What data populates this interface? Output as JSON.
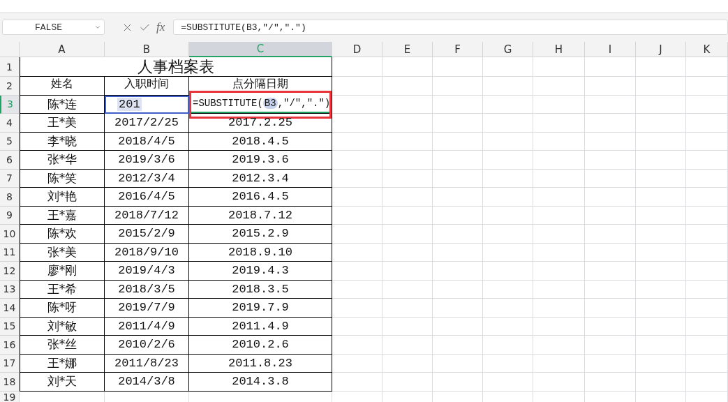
{
  "name_box": "FALSE",
  "formula_bar": {
    "function_label": "fx",
    "text": "=SUBSTITUTE(B3,″/″,″.″)"
  },
  "columns": [
    {
      "label": "A",
      "selected": false
    },
    {
      "label": "B",
      "selected": false
    },
    {
      "label": "C",
      "selected": true
    },
    {
      "label": "D",
      "selected": false
    },
    {
      "label": "E",
      "selected": false
    },
    {
      "label": "F",
      "selected": false
    },
    {
      "label": "G",
      "selected": false
    },
    {
      "label": "H",
      "selected": false
    },
    {
      "label": "I",
      "selected": false
    },
    {
      "label": "J",
      "selected": false
    },
    {
      "label": "K",
      "selected": false
    }
  ],
  "title": "人事档案表",
  "headers": [
    "姓名",
    "入职时间",
    "点分隔日期"
  ],
  "records": [
    {
      "row": "3",
      "selected": true,
      "name": "陈*连",
      "hired": "201",
      "editing": {
        "before": "=SUBSTITUTE(",
        "ref": "B3",
        "after": ",″/″,″.″)"
      }
    },
    {
      "row": "4",
      "selected": false,
      "name": "王*美",
      "hired": "2017/2/25",
      "dotted": "2017.2.25"
    },
    {
      "row": "5",
      "selected": false,
      "name": "李*晓",
      "hired": "2018/4/5",
      "dotted": "2018.4.5"
    },
    {
      "row": "6",
      "selected": false,
      "name": "张*华",
      "hired": "2019/3/6",
      "dotted": "2019.3.6"
    },
    {
      "row": "7",
      "selected": false,
      "name": "陈*笑",
      "hired": "2012/3/4",
      "dotted": "2012.3.4"
    },
    {
      "row": "8",
      "selected": false,
      "name": "刘*艳",
      "hired": "2016/4/5",
      "dotted": "2016.4.5"
    },
    {
      "row": "9",
      "selected": false,
      "name": "王*嘉",
      "hired": "2018/7/12",
      "dotted": "2018.7.12"
    },
    {
      "row": "10",
      "selected": false,
      "name": "陈*欢",
      "hired": "2015/2/9",
      "dotted": "2015.2.9"
    },
    {
      "row": "11",
      "selected": false,
      "name": "张*美",
      "hired": "2018/9/10",
      "dotted": "2018.9.10"
    },
    {
      "row": "12",
      "selected": false,
      "name": "廖*刚",
      "hired": "2019/4/3",
      "dotted": "2019.4.3"
    },
    {
      "row": "13",
      "selected": false,
      "name": "王*希",
      "hired": "2018/3/5",
      "dotted": "2018.3.5"
    },
    {
      "row": "14",
      "selected": false,
      "name": "陈*呀",
      "hired": "2019/7/9",
      "dotted": "2019.7.9"
    },
    {
      "row": "15",
      "selected": false,
      "name": "刘*敏",
      "hired": "2011/4/9",
      "dotted": "2011.4.9"
    },
    {
      "row": "16",
      "selected": false,
      "name": "张*丝",
      "hired": "2010/2/6",
      "dotted": "2010.2.6"
    },
    {
      "row": "17",
      "selected": false,
      "name": "王*娜",
      "hired": "2011/8/23",
      "dotted": "2011.8.23"
    },
    {
      "row": "18",
      "selected": false,
      "name": "刘*天",
      "hired": "2014/3/8",
      "dotted": "2014.3.8"
    }
  ],
  "top_rows": [
    "1",
    "2"
  ],
  "trailing_rows": [
    "19"
  ]
}
